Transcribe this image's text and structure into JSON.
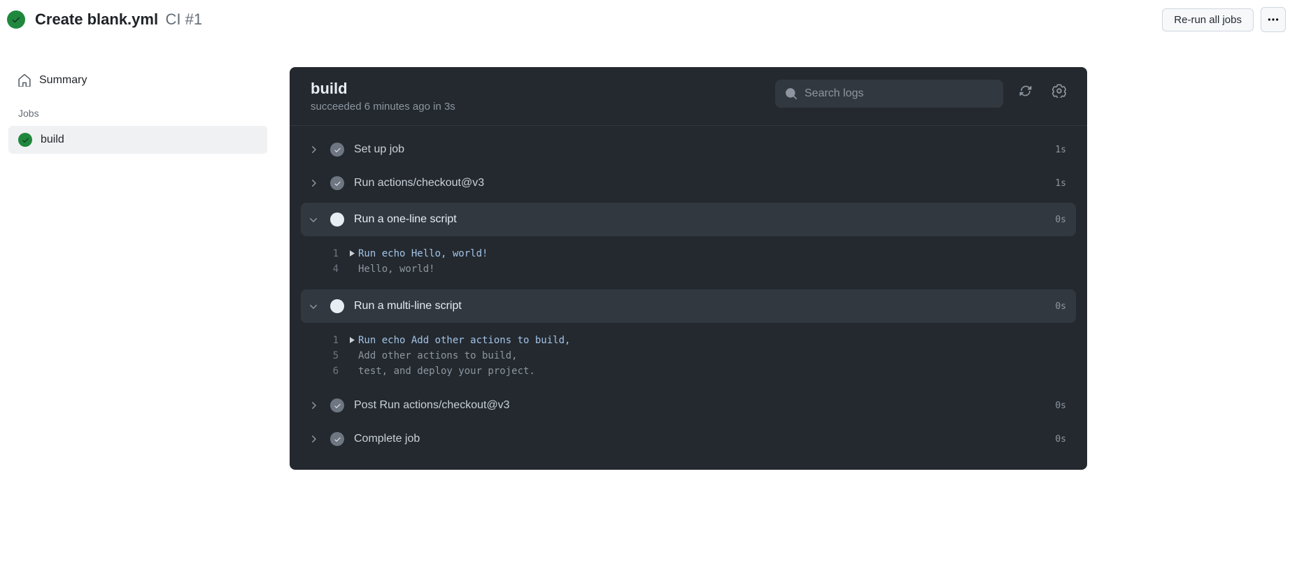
{
  "header": {
    "title": "Create blank.yml",
    "subtitle": "CI #1",
    "rerun_label": "Re-run all jobs"
  },
  "sidebar": {
    "summary_label": "Summary",
    "jobs_heading": "Jobs",
    "jobs": [
      {
        "name": "build"
      }
    ]
  },
  "panel": {
    "job_name": "build",
    "status_line": "succeeded 6 minutes ago in 3s",
    "search_placeholder": "Search logs"
  },
  "steps": [
    {
      "name": "Set up job",
      "duration": "1s",
      "expanded": false
    },
    {
      "name": "Run actions/checkout@v3",
      "duration": "1s",
      "expanded": false
    },
    {
      "name": "Run a one-line script",
      "duration": "0s",
      "expanded": true,
      "logs": [
        {
          "n": "1",
          "caret": true,
          "cmd": true,
          "text": "Run echo Hello, world!"
        },
        {
          "n": "4",
          "caret": false,
          "cmd": false,
          "text": "Hello, world!"
        }
      ]
    },
    {
      "name": "Run a multi-line script",
      "duration": "0s",
      "expanded": true,
      "logs": [
        {
          "n": "1",
          "caret": true,
          "cmd": true,
          "text": "Run echo Add other actions to build,"
        },
        {
          "n": "5",
          "caret": false,
          "cmd": false,
          "text": "Add other actions to build,"
        },
        {
          "n": "6",
          "caret": false,
          "cmd": false,
          "text": "test, and deploy your project."
        }
      ]
    },
    {
      "name": "Post Run actions/checkout@v3",
      "duration": "0s",
      "expanded": false
    },
    {
      "name": "Complete job",
      "duration": "0s",
      "expanded": false
    }
  ]
}
